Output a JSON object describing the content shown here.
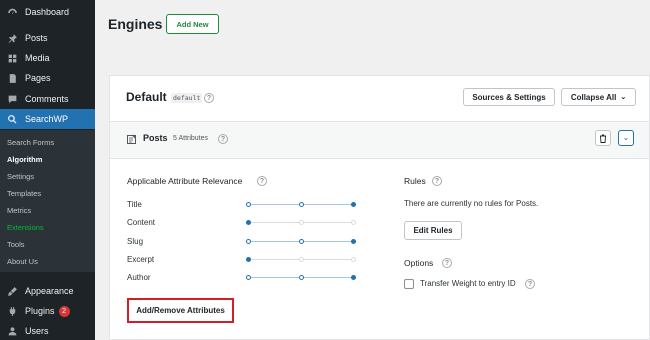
{
  "sidebar": {
    "menu": [
      {
        "label": "Dashboard",
        "icon": "dashboard-icon"
      },
      {
        "label": "Posts",
        "icon": "pin-icon"
      },
      {
        "label": "Media",
        "icon": "media-icon"
      },
      {
        "label": "Pages",
        "icon": "pages-icon"
      },
      {
        "label": "Comments",
        "icon": "comment-icon"
      },
      {
        "label": "SearchWP",
        "icon": "searchwp-icon"
      }
    ],
    "submenu": [
      "Search Forms",
      "Algorithm",
      "Settings",
      "Templates",
      "Metrics",
      "Extensions",
      "Tools",
      "About Us"
    ],
    "bottom_menu": [
      {
        "label": "Appearance",
        "icon": "brush-icon"
      },
      {
        "label": "Plugins",
        "icon": "plugin-icon",
        "badge": "2"
      },
      {
        "label": "Users",
        "icon": "users-icon"
      }
    ]
  },
  "header": {
    "title": "Engines",
    "add_new": "Add New"
  },
  "engine": {
    "title": "Default",
    "slug": "default",
    "sources_button": "Sources & Settings",
    "collapse_button": "Collapse All"
  },
  "source": {
    "title": "Posts",
    "attributes_count": "5 Attributes"
  },
  "relevance": {
    "heading": "Applicable Attribute Relevance",
    "attributes": [
      {
        "label": "Title",
        "level": 1.0
      },
      {
        "label": "Content",
        "level": 0.0
      },
      {
        "label": "Slug",
        "level": 1.0
      },
      {
        "label": "Excerpt",
        "level": 0.0
      },
      {
        "label": "Author",
        "level": 1.0
      }
    ],
    "add_remove_button": "Add/Remove Attributes"
  },
  "rules": {
    "heading": "Rules",
    "empty_text": "There are currently no rules for Posts.",
    "edit_button": "Edit Rules"
  },
  "options": {
    "heading": "Options",
    "transfer_weight_label": "Transfer Weight to entry ID",
    "transfer_weight_checked": false
  },
  "colors": {
    "accent": "#2271b1",
    "sidebar": "#1d2327",
    "highlight": "#d11f2a",
    "add_new": "#1e8a3c"
  }
}
